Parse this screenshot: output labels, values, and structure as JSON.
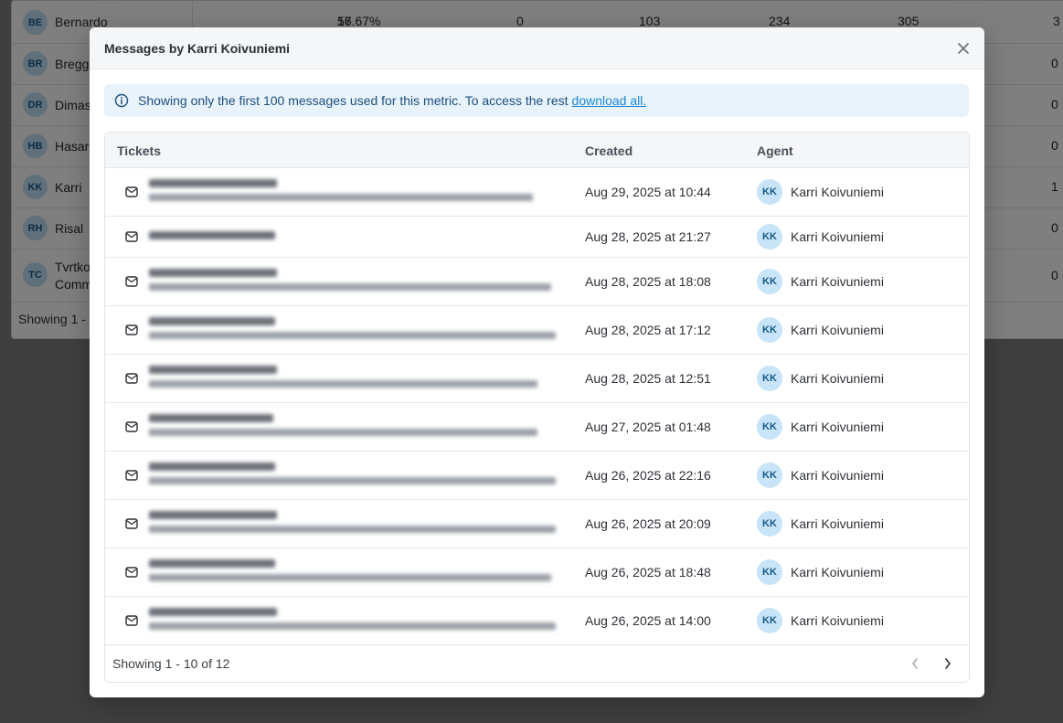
{
  "background_table": {
    "rows": [
      {
        "initials": "BE",
        "name": "Bernardo",
        "name2": "",
        "nums": [
          "17",
          "56.67%",
          "0",
          "103",
          "234",
          "305",
          "3"
        ]
      },
      {
        "initials": "BR",
        "name": "Bregg",
        "name2": "",
        "nums": [
          "",
          "",
          "",
          "",
          "",
          "",
          "0"
        ]
      },
      {
        "initials": "DR",
        "name": "Dimas",
        "name2": "",
        "nums": [
          "",
          "",
          "",
          "",
          "",
          "",
          "0"
        ]
      },
      {
        "initials": "HB",
        "name": "Hasar",
        "name2": "",
        "nums": [
          "",
          "",
          "",
          "",
          "",
          "",
          "0"
        ]
      },
      {
        "initials": "KK",
        "name": "Karri",
        "name2": "",
        "nums": [
          "",
          "",
          "",
          "",
          "",
          "",
          "1"
        ]
      },
      {
        "initials": "RH",
        "name": "Risal",
        "name2": "",
        "nums": [
          "",
          "",
          "",
          "",
          "",
          "",
          "0"
        ]
      },
      {
        "initials": "TC",
        "name": "Tvrtko",
        "name2": "Comm",
        "nums": [
          "",
          "",
          "",
          "",
          "",
          "",
          "0"
        ]
      }
    ],
    "footer": "Showing 1 -"
  },
  "modal": {
    "title": "Messages by Karri Koivuniemi",
    "banner": {
      "text": "Showing only the first 100 messages used for this metric. To access the rest",
      "link": "download all."
    },
    "columns": {
      "tickets": "Tickets",
      "created": "Created",
      "agent": "Agent"
    },
    "rows": [
      {
        "created": "Aug 29, 2025 at 10:44",
        "agent": "Karri Koivuniemi",
        "initials": "KK"
      },
      {
        "created": "Aug 28, 2025 at 21:27",
        "agent": "Karri Koivuniemi",
        "initials": "KK"
      },
      {
        "created": "Aug 28, 2025 at 18:08",
        "agent": "Karri Koivuniemi",
        "initials": "KK"
      },
      {
        "created": "Aug 28, 2025 at 17:12",
        "agent": "Karri Koivuniemi",
        "initials": "KK"
      },
      {
        "created": "Aug 28, 2025 at 12:51",
        "agent": "Karri Koivuniemi",
        "initials": "KK"
      },
      {
        "created": "Aug 27, 2025 at 01:48",
        "agent": "Karri Koivuniemi",
        "initials": "KK"
      },
      {
        "created": "Aug 26, 2025 at 22:16",
        "agent": "Karri Koivuniemi",
        "initials": "KK"
      },
      {
        "created": "Aug 26, 2025 at 20:09",
        "agent": "Karri Koivuniemi",
        "initials": "KK"
      },
      {
        "created": "Aug 26, 2025 at 18:48",
        "agent": "Karri Koivuniemi",
        "initials": "KK"
      },
      {
        "created": "Aug 26, 2025 at 14:00",
        "agent": "Karri Koivuniemi",
        "initials": "KK"
      }
    ],
    "pagination": "Showing 1 - 10 of 12"
  },
  "icons": {
    "close": "close-icon",
    "info": "info-icon",
    "mail": "mail-icon",
    "prev": "chevron-left-icon",
    "next": "chevron-right-icon"
  },
  "colors": {
    "accent": "#1e88d0",
    "banner_bg": "#e8f3fc",
    "avatar_bg": "#c7e4f8"
  }
}
